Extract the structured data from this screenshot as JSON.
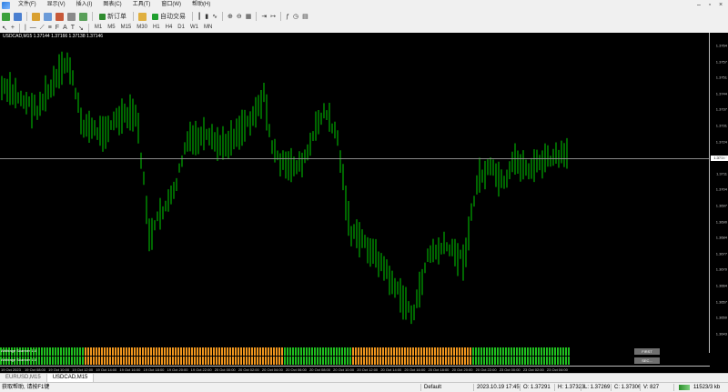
{
  "menu": {
    "items": [
      "文件(F)",
      "显示(V)",
      "插入(I)",
      "图表(C)",
      "工具(T)",
      "窗口(W)",
      "帮助(H)"
    ]
  },
  "toolbar": {
    "new_order_label": "新订单",
    "autotrading_label": "自动交易",
    "timeframes": [
      "M1",
      "M5",
      "M15",
      "M30",
      "H1",
      "H4",
      "D1",
      "W1",
      "MN"
    ]
  },
  "chart": {
    "title": "USDCAD,M15  1.37144 1.37166 1.37138 1.37146",
    "current_price": "1.3714",
    "price_ticks": [
      "1.3764",
      "1.3757",
      "1.3751",
      "1.3744",
      "1.3737",
      "1.3731",
      "1.3724",
      "1.3717",
      "1.3711",
      "1.3704",
      "1.3697",
      "1.3690",
      "1.3684",
      "1.3677",
      "1.3670",
      "1.3664",
      "1.3657",
      "1.3650",
      "1.3643"
    ],
    "time_ticks": [
      "19 Oct 2023",
      "19 Oct 08:00",
      "19 Oct 10:00",
      "19 Oct 12:00",
      "19 Oct 14:00",
      "19 Oct 16:00",
      "19 Oct 18:00",
      "19 Oct 20:00",
      "19 Oct 22:00",
      "20 Oct 00:00",
      "20 Oct 02:00",
      "20 Oct 04:00",
      "20 Oct 06:00",
      "20 Oct 08:00",
      "20 Oct 10:00",
      "20 Oct 12:00",
      "20 Oct 14:00",
      "20 Oct 16:00",
      "20 Oct 18:00",
      "20 Oct 20:00",
      "20 Oct 22:00",
      "23 Oct 00:00",
      "23 Oct 02:00",
      "23 Oct 04:00"
    ],
    "colors": {
      "candle": "#00cc00",
      "bull": "#1fbf1f",
      "bear": "#f0961e",
      "background": "#000000"
    }
  },
  "indicators": [
    {
      "label": "Arbitrage Scanner 1.0",
      "button": "FIRST"
    },
    {
      "label": "Arbitrage Scanner 1.0",
      "button": "SEC..."
    }
  ],
  "tabs": [
    "EURUSD,M15",
    "USDCAD,M15"
  ],
  "status": {
    "help": "获取帮助, 请按F1键",
    "profile": "Default",
    "datetime": "2023.10.19 17:45",
    "open": "O: 1.37291",
    "high": "H: 1.37323",
    "low": "L: 1.37269",
    "close": "C: 1.37306",
    "volume": "V: 827",
    "traffic": "11523/3 kb"
  }
}
